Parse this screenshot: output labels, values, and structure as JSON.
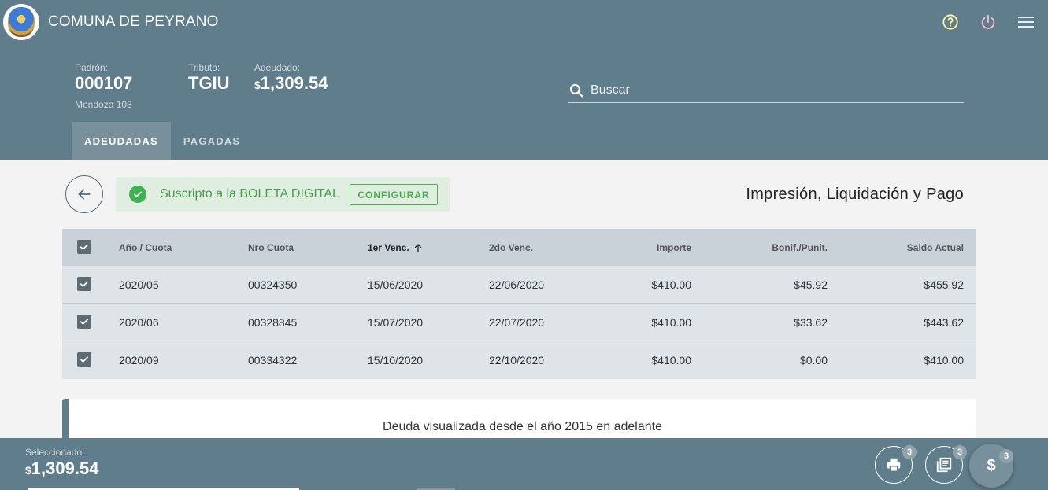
{
  "app": {
    "title": "COMUNA DE PEYRANO"
  },
  "header_icons": {
    "help": "help-circle-icon",
    "power": "power-icon",
    "menu": "hamburger-menu-icon"
  },
  "account": {
    "padron_label": "Padrón:",
    "padron_value": "000107",
    "address": "Mendoza 103",
    "tributo_label": "Tributo:",
    "tributo_value": "TGIU",
    "adeudado_label": "Adeudado:",
    "adeudado_currency": "$",
    "adeudado_value": "1,309.54"
  },
  "search": {
    "placeholder": "Buscar"
  },
  "tabs": [
    {
      "label": "ADEUDADAS",
      "active": true
    },
    {
      "label": "PAGADAS",
      "active": false
    }
  ],
  "subscription": {
    "text": "Suscripto a la BOLETA DIGITAL",
    "button": "CONFIGURAR"
  },
  "section_title": "Impresión, Liquidación y Pago",
  "table": {
    "headers": {
      "anio": "Año / Cuota",
      "nro": "Nro Cuota",
      "venc1": "1er Venc.",
      "venc2": "2do Venc.",
      "importe": "Importe",
      "bonif": "Bonif./Punit.",
      "saldo": "Saldo Actual"
    },
    "rows": [
      {
        "anio": "2020/05",
        "nro": "00324350",
        "venc1": "15/06/2020",
        "venc2": "22/06/2020",
        "importe": "$410.00",
        "bonif": "$45.92",
        "saldo": "$455.92",
        "checked": true
      },
      {
        "anio": "2020/06",
        "nro": "00328845",
        "venc1": "15/07/2020",
        "venc2": "22/07/2020",
        "importe": "$410.00",
        "bonif": "$33.62",
        "saldo": "$443.62",
        "checked": true
      },
      {
        "anio": "2020/09",
        "nro": "00334322",
        "venc1": "15/10/2020",
        "venc2": "22/10/2020",
        "importe": "$410.00",
        "bonif": "$0.00",
        "saldo": "$410.00",
        "checked": true
      }
    ]
  },
  "notice": "Deuda visualizada desde el año 2015 en adelante",
  "footer": {
    "selected_label": "Seleccionado:",
    "selected_currency": "$",
    "selected_value": "1,309.54",
    "print_badge": "3",
    "book_badge": "3",
    "pay_label": "$",
    "pay_badge": "3"
  },
  "colors": {
    "header": "#607d8b",
    "active_tab": "#78909c",
    "success_green": "#43a047",
    "help_icon": "#fff59d",
    "power_icon": "#f8bbd0"
  }
}
